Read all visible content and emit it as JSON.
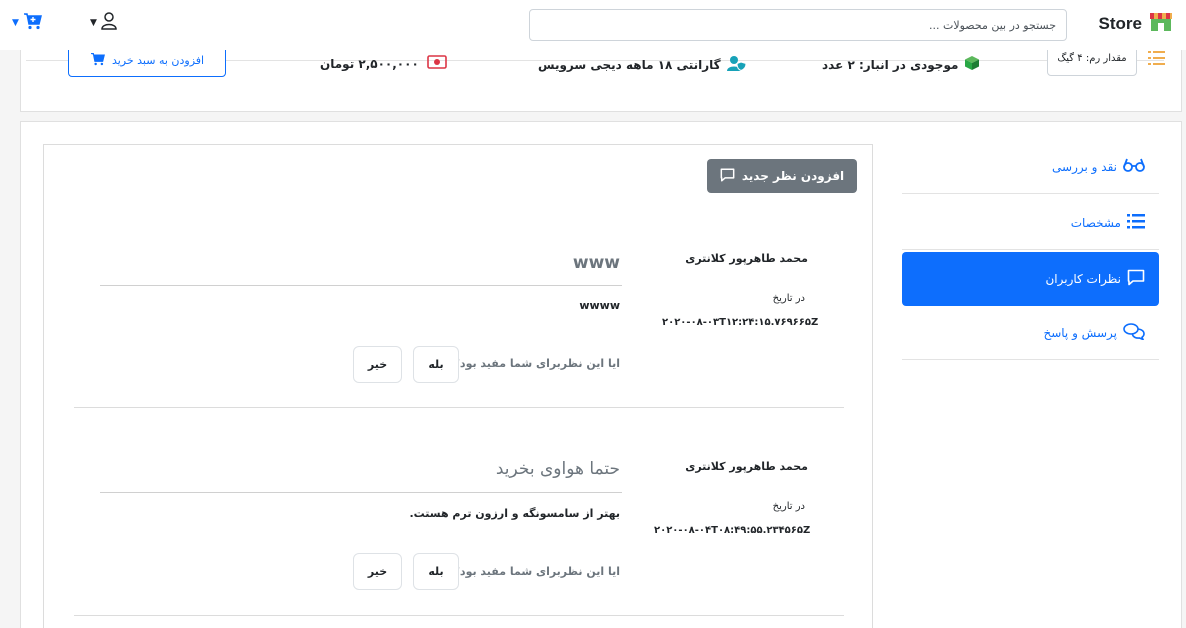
{
  "navbar": {
    "brand": "Store",
    "search_placeholder": "جستجو در بین محصولات ..."
  },
  "product": {
    "ram_label": "مقدار رم: ۴ گیگ",
    "stock": "موجودی در انبار: ۲ عدد",
    "warranty": "گارانتی ۱۸ ماهه دیجی سرویس",
    "price": "۲,۵۰۰,۰۰۰ تومان",
    "add_to_cart": "افزودن به سبد خرید"
  },
  "tabs": [
    {
      "label": "نقد و بررسی",
      "icon": "glasses-icon"
    },
    {
      "label": "مشخصات",
      "icon": "list-icon"
    },
    {
      "label": "نظرات کاربران",
      "icon": "comment-icon"
    },
    {
      "label": "پرسش و پاسخ",
      "icon": "comments-icon"
    }
  ],
  "comments_panel": {
    "add_comment": "افزودن نظر جدید",
    "items": [
      {
        "author": "محمد طاهرپور کلانتری",
        "date_label": "در تاریخ",
        "date": "۲۰۲۰-۰۸-۰۳T۱۲:۲۴:۱۵.۷۶۹۶۶۵Z",
        "title": "www",
        "body": "wwww",
        "question": "ایا این نظربرای شما مفید بود؟",
        "yes": "بله",
        "no": "خیر"
      },
      {
        "author": "محمد طاهرپور کلانتری",
        "date_label": "در تاریخ",
        "date": "۲۰۲۰-۰۸-۰۴T۰۸:۴۹:۵۵.۲۳۴۵۶۵Z",
        "title": "حتما هواوی بخرید",
        "body": "بهتر از سامسونگه و ارزون ترم هستت.",
        "question": "ایا این نظربرای شما مفید بود؟",
        "yes": "بله",
        "no": "خیر"
      }
    ]
  },
  "colors": {
    "primary": "#0d6efd",
    "secondary": "#6c757d",
    "success": "#28a745",
    "danger": "#dc3545",
    "info": "#17a2b8",
    "warning": "#f0ad4e"
  }
}
